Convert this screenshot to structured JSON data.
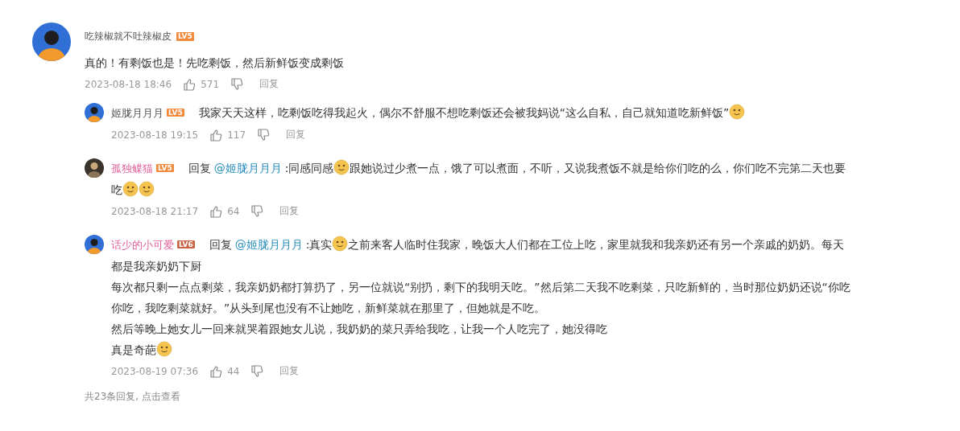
{
  "comment": {
    "author": {
      "name": "吃辣椒就不吐辣椒皮",
      "level": "LV5",
      "color": "#555555"
    },
    "lines": [
      [
        {
          "kind": "text",
          "text": "真的！有剩饭也是！先吃剩饭，然后新鲜饭变成剩饭"
        }
      ]
    ],
    "time": "2023-08-18 18:46",
    "likes": "571",
    "reply_label": "回复"
  },
  "replies": [
    {
      "author": {
        "name": "姬胧月月月",
        "level": "LV5",
        "color": "#555555"
      },
      "lines": [
        [
          {
            "kind": "text",
            "text": "我家天天这样，吃剩饭吃得我起火，偶尔不舒服不想吃剩饭还会被我妈说“这么自私，自己就知道吃新鲜饭”"
          },
          {
            "kind": "emoji"
          }
        ]
      ],
      "time": "2023-08-18 19:15",
      "likes": "117",
      "reply_label": "回复"
    },
    {
      "author": {
        "name": "孤独鲽猫",
        "level": "LV5",
        "color": "#e0609a"
      },
      "lines": [
        [
          {
            "kind": "text",
            "text": "回复"
          },
          {
            "kind": "mention",
            "text": "@姬胧月月月"
          },
          {
            "kind": "text",
            "text": ":同感同感"
          },
          {
            "kind": "emoji"
          },
          {
            "kind": "text",
            "text": "跟她说过少煮一点，饿了可以煮面，不听，又说我煮饭不就是给你们吃的么，你们吃不完第二天也要"
          }
        ],
        [
          {
            "kind": "text",
            "text": "吃"
          },
          {
            "kind": "emoji"
          },
          {
            "kind": "emoji"
          }
        ]
      ],
      "time": "2023-08-18 21:17",
      "likes": "64",
      "reply_label": "回复"
    },
    {
      "author": {
        "name": "话少的小可爱",
        "level": "LV6",
        "color": "#e0609a"
      },
      "lines": [
        [
          {
            "kind": "text",
            "text": "回复"
          },
          {
            "kind": "mention",
            "text": "@姬胧月月月"
          },
          {
            "kind": "text",
            "text": ":真实"
          },
          {
            "kind": "emoji"
          },
          {
            "kind": "text",
            "text": "之前来客人临时住我家，晚饭大人们都在工位上吃，家里就我和我亲奶还有另一个亲戚的奶奶。每天"
          }
        ],
        [
          {
            "kind": "text",
            "text": "都是我亲奶奶下厨"
          }
        ],
        [
          {
            "kind": "text",
            "text": "每次都只剩一点点剩菜，我亲奶奶都打算扔了，另一位就说“别扔，剩下的我明天吃。”然后第二天我不吃剩菜，只吃新鲜的，当时那位奶奶还说“你吃"
          }
        ],
        [
          {
            "kind": "text",
            "text": "你吃，我吃剩菜就好。”从头到尾也没有不让她吃，新鲜菜就在那里了，但她就是不吃。"
          }
        ],
        [
          {
            "kind": "text",
            "text": "然后等晚上她女儿一回来就哭着跟她女儿说，我奶奶的菜只弄给我吃，让我一个人吃完了，她没得吃"
          }
        ],
        [
          {
            "kind": "text",
            "text": "真是奇葩"
          },
          {
            "kind": "emoji"
          }
        ]
      ],
      "time": "2023-08-19 07:36",
      "likes": "44",
      "reply_label": "回复"
    }
  ],
  "more_replies": "共23条回复, 点击查看"
}
